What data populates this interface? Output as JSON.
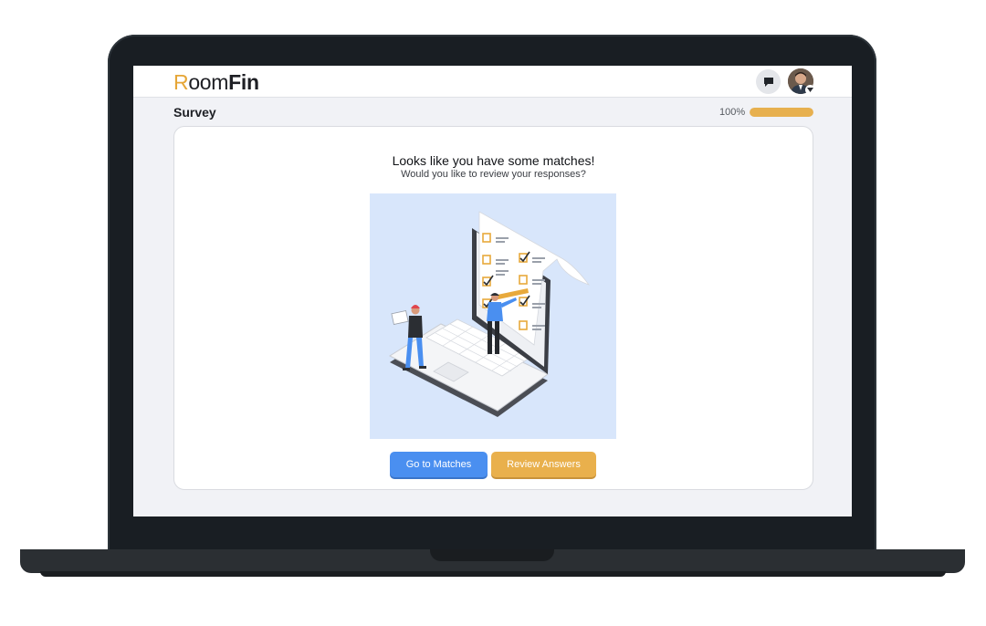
{
  "app": {
    "logo_first": "R",
    "logo_rest": "oom",
    "logo_bold": "Fin",
    "brand_color": "#e6a637"
  },
  "header": {
    "chat_icon": "chat-bubble-icon",
    "avatar_icon": "user-avatar"
  },
  "survey": {
    "title": "Survey",
    "progress_label": "100%",
    "progress_value": 1.0
  },
  "result": {
    "heading": "Looks like you have some matches!",
    "subheading": "Would you like to review your responses?",
    "illustration": "checklist-laptop-illustration"
  },
  "actions": {
    "go_to_matches": "Go to Matches",
    "review_answers": "Review Answers",
    "primary_color": "#4a8ff0",
    "secondary_color": "#e9b04c"
  }
}
